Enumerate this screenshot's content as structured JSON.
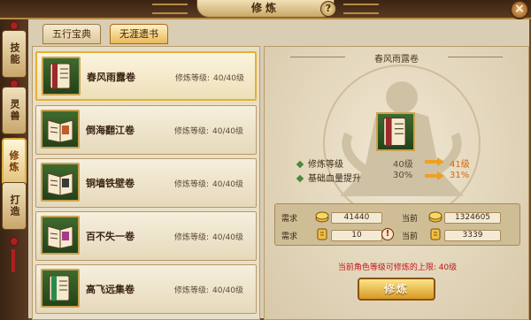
{
  "header": {
    "title": "修炼",
    "help_glyph": "?",
    "close_glyph": "×"
  },
  "side_tabs": [
    {
      "label": "技能",
      "active": false
    },
    {
      "label": "灵兽",
      "active": false
    },
    {
      "label": "修炼",
      "active": true
    },
    {
      "label": "打造",
      "active": false
    }
  ],
  "inner_tabs": [
    {
      "label": "五行宝典",
      "active": false
    },
    {
      "label": "无涯遗书",
      "active": true
    }
  ],
  "books": [
    {
      "name": "春风雨露卷",
      "level_label": "修炼等级:",
      "level_value": "40/40级",
      "selected": true,
      "cover_color": "#9b2a2a"
    },
    {
      "name": "倒海翻江卷",
      "level_label": "修炼等级:",
      "level_value": "40/40级",
      "selected": false,
      "cover_color": "#c25a2a"
    },
    {
      "name": "铜墙铁壁卷",
      "level_label": "修炼等级:",
      "level_value": "40/40级",
      "selected": false,
      "cover_color": "#3a3a3a"
    },
    {
      "name": "百不失一卷",
      "level_label": "修炼等级:",
      "level_value": "40/40级",
      "selected": false,
      "cover_color": "#a83a8a"
    },
    {
      "name": "高飞远集卷",
      "level_label": "修炼等级:",
      "level_value": "40/40级",
      "selected": false,
      "cover_color": "#2a8a4a"
    }
  ],
  "detail": {
    "title": "春风雨露卷",
    "stats": [
      {
        "label": "修炼等级",
        "current": "40级",
        "next": "41级"
      },
      {
        "label": "基础血量提升",
        "current": "30%",
        "next": "31%"
      }
    ],
    "requirements": [
      {
        "req_label": "需求",
        "req_value": "41440",
        "cur_label": "当前",
        "cur_value": "1324605",
        "icon": "coin-icon"
      },
      {
        "req_label": "需求",
        "req_value": "10",
        "cur_label": "当前",
        "cur_value": "3339",
        "icon": "token-icon",
        "warning": "!"
      }
    ],
    "warning_text": "当前角色等级可修炼的上限: 40级",
    "train_button": "修炼"
  },
  "colors": {
    "accent_gold": "#e8b030",
    "warning_red": "#c01818",
    "next_value_orange": "#d06a10"
  }
}
